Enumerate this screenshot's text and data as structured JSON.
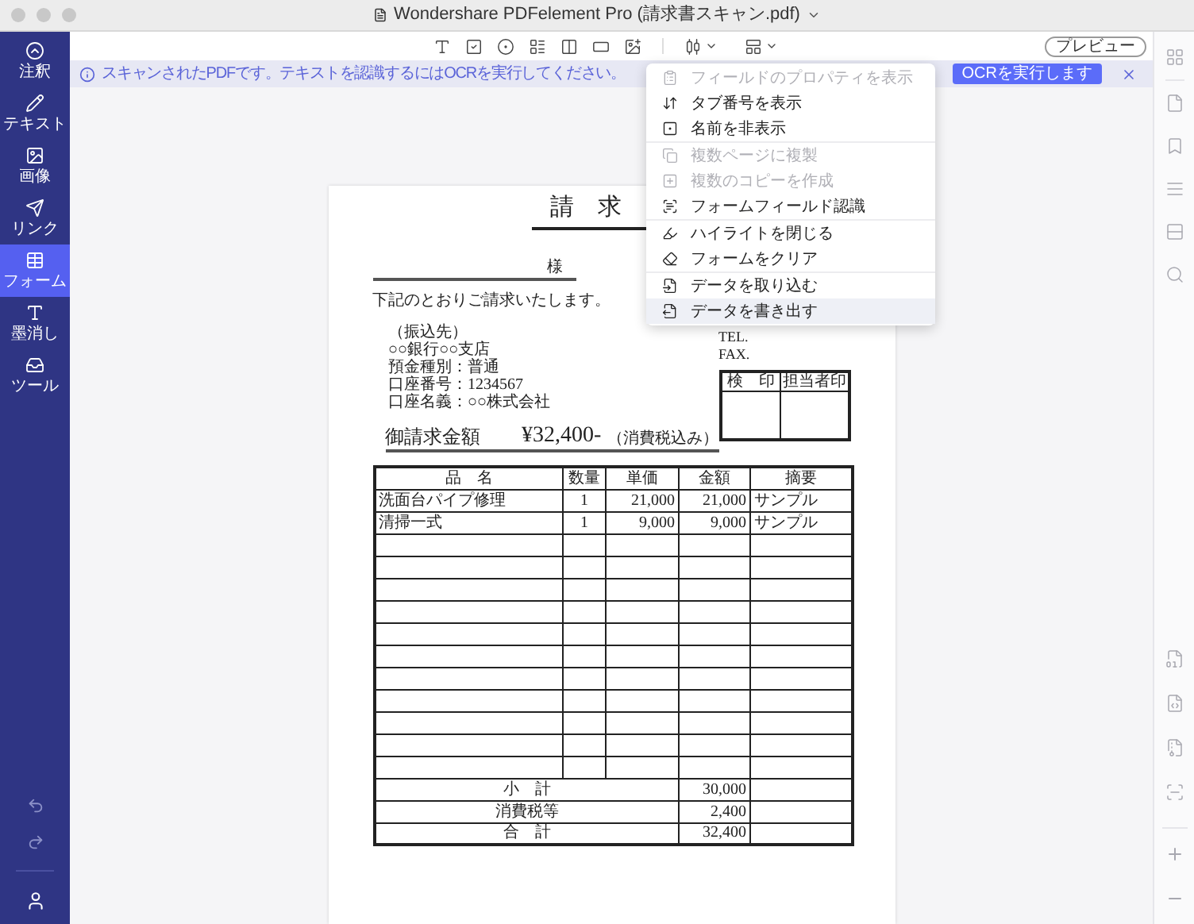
{
  "window": {
    "title": "Wondershare PDFelement Pro (請求書スキャン.pdf)"
  },
  "sidebar": {
    "items": [
      {
        "label": "注釈",
        "selected": false
      },
      {
        "label": "テキスト",
        "selected": false
      },
      {
        "label": "画像",
        "selected": false
      },
      {
        "label": "リンク",
        "selected": false
      },
      {
        "label": "フォーム",
        "selected": true
      },
      {
        "label": "墨消し",
        "selected": false
      },
      {
        "label": "ツール",
        "selected": false
      }
    ]
  },
  "toolbar": {
    "preview_button": "プレビュー"
  },
  "banner": {
    "message": "スキャンされたPDFです。テキストを認識するにはOCRを実行してください。",
    "button": "OCRを実行します"
  },
  "menu": {
    "sections": [
      {
        "items": [
          {
            "label": "フィールドのプロパティを表示",
            "disabled": true,
            "selected": false
          },
          {
            "label": "タブ番号を表示",
            "disabled": false,
            "selected": false
          },
          {
            "label": "名前を非表示",
            "disabled": false,
            "selected": false
          }
        ]
      },
      {
        "items": [
          {
            "label": "複数ページに複製",
            "disabled": true,
            "selected": false
          },
          {
            "label": "複数のコピーを作成",
            "disabled": true,
            "selected": false
          },
          {
            "label": "フォームフィールド認識",
            "disabled": false,
            "selected": false
          }
        ]
      },
      {
        "items": [
          {
            "label": "ハイライトを閉じる",
            "disabled": false,
            "selected": false
          },
          {
            "label": "フォームをクリア",
            "disabled": false,
            "selected": false
          }
        ]
      },
      {
        "items": [
          {
            "label": "データを取り込む",
            "disabled": false,
            "selected": false
          },
          {
            "label": "データを書き出す",
            "disabled": false,
            "selected": true
          }
        ]
      }
    ]
  },
  "document": {
    "title": "請　求",
    "addressee_suffix": "様",
    "greeting": "下記のとおりご請求いたします。",
    "bank_lines": [
      "（振込先）",
      "○○銀行○○支店",
      "預金種別：普通",
      "口座番号：1234567",
      "口座名義：○○株式会社"
    ],
    "contact_lines": [
      "TEL.",
      "FAX."
    ],
    "stamp_columns": [
      "検　印",
      "担当者印"
    ],
    "amount_label": "御請求金額",
    "amount": "¥32,400-",
    "amount_note": "（消費税込み）",
    "table": {
      "columns": [
        "品　名",
        "数量",
        "単価",
        "金額",
        "摘要"
      ],
      "rows": [
        {
          "cells": [
            "洗面台パイプ修理",
            "1",
            "21,000",
            "21,000",
            "サンプル"
          ]
        },
        {
          "cells": [
            "清掃一式",
            "1",
            "9,000",
            "9,000",
            "サンプル"
          ]
        }
      ],
      "summary": [
        {
          "label": "小　計",
          "amount": "30,000"
        },
        {
          "label": "消費税等",
          "amount": "2,400"
        },
        {
          "label": "合　計",
          "amount": "32,400"
        }
      ]
    }
  }
}
